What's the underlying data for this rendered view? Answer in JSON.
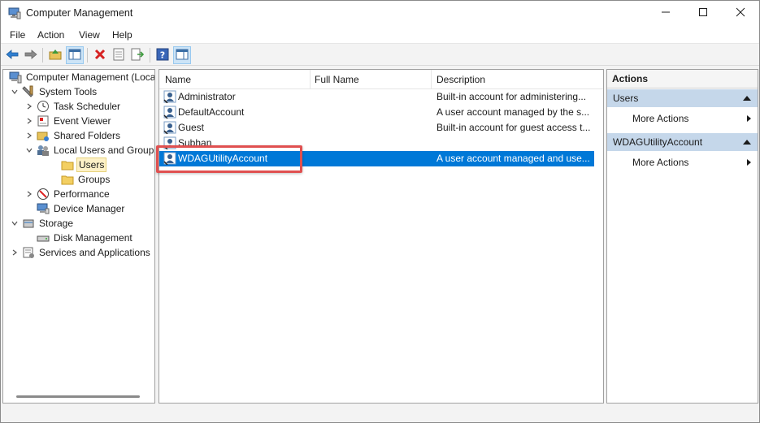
{
  "window": {
    "title": "Computer Management",
    "icon": "computer-management-icon",
    "controls": [
      "minimize-icon",
      "maximize-icon",
      "close-icon"
    ]
  },
  "menu": [
    "File",
    "Action",
    "View",
    "Help"
  ],
  "toolbar": {
    "buttons": [
      "back-icon",
      "forward-icon",
      "up-folder-icon",
      "show-hide-tree-icon",
      "delete-icon",
      "properties-icon",
      "export-list-icon",
      "help-icon",
      "show-hide-action-pane-icon"
    ]
  },
  "tree": {
    "items": [
      {
        "label": "Computer Management (Local",
        "icon": "computer-management-icon",
        "expander": "",
        "level": 0
      },
      {
        "label": "System Tools",
        "icon": "tools-icon",
        "expander": "expanded",
        "level": 1
      },
      {
        "label": "Task Scheduler",
        "icon": "clock-icon",
        "expander": "collapsed",
        "level": 2
      },
      {
        "label": "Event Viewer",
        "icon": "event-viewer-icon",
        "expander": "collapsed",
        "level": 2
      },
      {
        "label": "Shared Folders",
        "icon": "shared-folder-icon",
        "expander": "collapsed",
        "level": 2
      },
      {
        "label": "Local Users and Groups",
        "icon": "users-groups-icon",
        "expander": "expanded",
        "level": 2
      },
      {
        "label": "Users",
        "icon": "folder-icon",
        "expander": "",
        "level": 3,
        "selected": true
      },
      {
        "label": "Groups",
        "icon": "folder-icon",
        "expander": "",
        "level": 3
      },
      {
        "label": "Performance",
        "icon": "performance-icon",
        "expander": "collapsed",
        "level": 2
      },
      {
        "label": "Device Manager",
        "icon": "device-manager-icon",
        "expander": "",
        "level": 2
      },
      {
        "label": "Storage",
        "icon": "storage-icon",
        "expander": "expanded",
        "level": 1
      },
      {
        "label": "Disk Management",
        "icon": "disk-icon",
        "expander": "",
        "level": 2
      },
      {
        "label": "Services and Applications",
        "icon": "services-icon",
        "expander": "collapsed",
        "level": 1
      }
    ]
  },
  "list": {
    "columns": [
      "Name",
      "Full Name",
      "Description"
    ],
    "rows": [
      {
        "name": "Administrator",
        "full_name": "",
        "description": "Built-in account for administering..."
      },
      {
        "name": "DefaultAccount",
        "full_name": "",
        "description": "A user account managed by the s..."
      },
      {
        "name": "Guest",
        "full_name": "",
        "description": "Built-in account for guest access t..."
      },
      {
        "name": "Subhan",
        "full_name": "",
        "description": ""
      },
      {
        "name": "WDAGUtilityAccount",
        "full_name": "",
        "description": "A user account managed and use...",
        "selected": true
      }
    ]
  },
  "actions": {
    "title": "Actions",
    "sections": [
      {
        "label": "Users",
        "items": [
          "More Actions"
        ]
      },
      {
        "label": "WDAGUtilityAccount",
        "items": [
          "More Actions"
        ]
      }
    ]
  },
  "colors": {
    "selection": "#0078d7",
    "section_header": "#c5d7ea",
    "highlight_box": "#e05050"
  }
}
